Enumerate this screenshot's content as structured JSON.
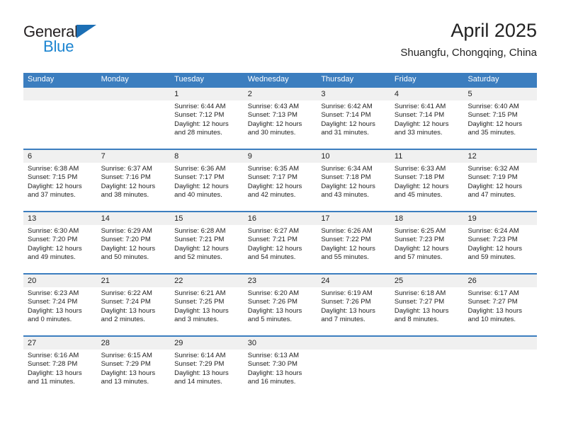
{
  "brand": {
    "name_part1": "General",
    "name_part2": "Blue",
    "accent_color": "#1b84d0",
    "triangle_color": "#1c6fb5"
  },
  "header": {
    "title": "April 2025",
    "subtitle": "Shuangfu, Chongqing, China"
  },
  "calendar": {
    "header_bg": "#3c7ebf",
    "day_band_bg": "#f0f0f0",
    "weekdays": [
      "Sunday",
      "Monday",
      "Tuesday",
      "Wednesday",
      "Thursday",
      "Friday",
      "Saturday"
    ],
    "weeks": [
      [
        {
          "day": "",
          "sunrise": "",
          "sunset": "",
          "daylight": ""
        },
        {
          "day": "",
          "sunrise": "",
          "sunset": "",
          "daylight": ""
        },
        {
          "day": "1",
          "sunrise": "Sunrise: 6:44 AM",
          "sunset": "Sunset: 7:12 PM",
          "daylight": "Daylight: 12 hours and 28 minutes."
        },
        {
          "day": "2",
          "sunrise": "Sunrise: 6:43 AM",
          "sunset": "Sunset: 7:13 PM",
          "daylight": "Daylight: 12 hours and 30 minutes."
        },
        {
          "day": "3",
          "sunrise": "Sunrise: 6:42 AM",
          "sunset": "Sunset: 7:14 PM",
          "daylight": "Daylight: 12 hours and 31 minutes."
        },
        {
          "day": "4",
          "sunrise": "Sunrise: 6:41 AM",
          "sunset": "Sunset: 7:14 PM",
          "daylight": "Daylight: 12 hours and 33 minutes."
        },
        {
          "day": "5",
          "sunrise": "Sunrise: 6:40 AM",
          "sunset": "Sunset: 7:15 PM",
          "daylight": "Daylight: 12 hours and 35 minutes."
        }
      ],
      [
        {
          "day": "6",
          "sunrise": "Sunrise: 6:38 AM",
          "sunset": "Sunset: 7:15 PM",
          "daylight": "Daylight: 12 hours and 37 minutes."
        },
        {
          "day": "7",
          "sunrise": "Sunrise: 6:37 AM",
          "sunset": "Sunset: 7:16 PM",
          "daylight": "Daylight: 12 hours and 38 minutes."
        },
        {
          "day": "8",
          "sunrise": "Sunrise: 6:36 AM",
          "sunset": "Sunset: 7:17 PM",
          "daylight": "Daylight: 12 hours and 40 minutes."
        },
        {
          "day": "9",
          "sunrise": "Sunrise: 6:35 AM",
          "sunset": "Sunset: 7:17 PM",
          "daylight": "Daylight: 12 hours and 42 minutes."
        },
        {
          "day": "10",
          "sunrise": "Sunrise: 6:34 AM",
          "sunset": "Sunset: 7:18 PM",
          "daylight": "Daylight: 12 hours and 43 minutes."
        },
        {
          "day": "11",
          "sunrise": "Sunrise: 6:33 AM",
          "sunset": "Sunset: 7:18 PM",
          "daylight": "Daylight: 12 hours and 45 minutes."
        },
        {
          "day": "12",
          "sunrise": "Sunrise: 6:32 AM",
          "sunset": "Sunset: 7:19 PM",
          "daylight": "Daylight: 12 hours and 47 minutes."
        }
      ],
      [
        {
          "day": "13",
          "sunrise": "Sunrise: 6:30 AM",
          "sunset": "Sunset: 7:20 PM",
          "daylight": "Daylight: 12 hours and 49 minutes."
        },
        {
          "day": "14",
          "sunrise": "Sunrise: 6:29 AM",
          "sunset": "Sunset: 7:20 PM",
          "daylight": "Daylight: 12 hours and 50 minutes."
        },
        {
          "day": "15",
          "sunrise": "Sunrise: 6:28 AM",
          "sunset": "Sunset: 7:21 PM",
          "daylight": "Daylight: 12 hours and 52 minutes."
        },
        {
          "day": "16",
          "sunrise": "Sunrise: 6:27 AM",
          "sunset": "Sunset: 7:21 PM",
          "daylight": "Daylight: 12 hours and 54 minutes."
        },
        {
          "day": "17",
          "sunrise": "Sunrise: 6:26 AM",
          "sunset": "Sunset: 7:22 PM",
          "daylight": "Daylight: 12 hours and 55 minutes."
        },
        {
          "day": "18",
          "sunrise": "Sunrise: 6:25 AM",
          "sunset": "Sunset: 7:23 PM",
          "daylight": "Daylight: 12 hours and 57 minutes."
        },
        {
          "day": "19",
          "sunrise": "Sunrise: 6:24 AM",
          "sunset": "Sunset: 7:23 PM",
          "daylight": "Daylight: 12 hours and 59 minutes."
        }
      ],
      [
        {
          "day": "20",
          "sunrise": "Sunrise: 6:23 AM",
          "sunset": "Sunset: 7:24 PM",
          "daylight": "Daylight: 13 hours and 0 minutes."
        },
        {
          "day": "21",
          "sunrise": "Sunrise: 6:22 AM",
          "sunset": "Sunset: 7:24 PM",
          "daylight": "Daylight: 13 hours and 2 minutes."
        },
        {
          "day": "22",
          "sunrise": "Sunrise: 6:21 AM",
          "sunset": "Sunset: 7:25 PM",
          "daylight": "Daylight: 13 hours and 3 minutes."
        },
        {
          "day": "23",
          "sunrise": "Sunrise: 6:20 AM",
          "sunset": "Sunset: 7:26 PM",
          "daylight": "Daylight: 13 hours and 5 minutes."
        },
        {
          "day": "24",
          "sunrise": "Sunrise: 6:19 AM",
          "sunset": "Sunset: 7:26 PM",
          "daylight": "Daylight: 13 hours and 7 minutes."
        },
        {
          "day": "25",
          "sunrise": "Sunrise: 6:18 AM",
          "sunset": "Sunset: 7:27 PM",
          "daylight": "Daylight: 13 hours and 8 minutes."
        },
        {
          "day": "26",
          "sunrise": "Sunrise: 6:17 AM",
          "sunset": "Sunset: 7:27 PM",
          "daylight": "Daylight: 13 hours and 10 minutes."
        }
      ],
      [
        {
          "day": "27",
          "sunrise": "Sunrise: 6:16 AM",
          "sunset": "Sunset: 7:28 PM",
          "daylight": "Daylight: 13 hours and 11 minutes."
        },
        {
          "day": "28",
          "sunrise": "Sunrise: 6:15 AM",
          "sunset": "Sunset: 7:29 PM",
          "daylight": "Daylight: 13 hours and 13 minutes."
        },
        {
          "day": "29",
          "sunrise": "Sunrise: 6:14 AM",
          "sunset": "Sunset: 7:29 PM",
          "daylight": "Daylight: 13 hours and 14 minutes."
        },
        {
          "day": "30",
          "sunrise": "Sunrise: 6:13 AM",
          "sunset": "Sunset: 7:30 PM",
          "daylight": "Daylight: 13 hours and 16 minutes."
        },
        {
          "day": "",
          "sunrise": "",
          "sunset": "",
          "daylight": ""
        },
        {
          "day": "",
          "sunrise": "",
          "sunset": "",
          "daylight": ""
        },
        {
          "day": "",
          "sunrise": "",
          "sunset": "",
          "daylight": ""
        }
      ]
    ]
  }
}
